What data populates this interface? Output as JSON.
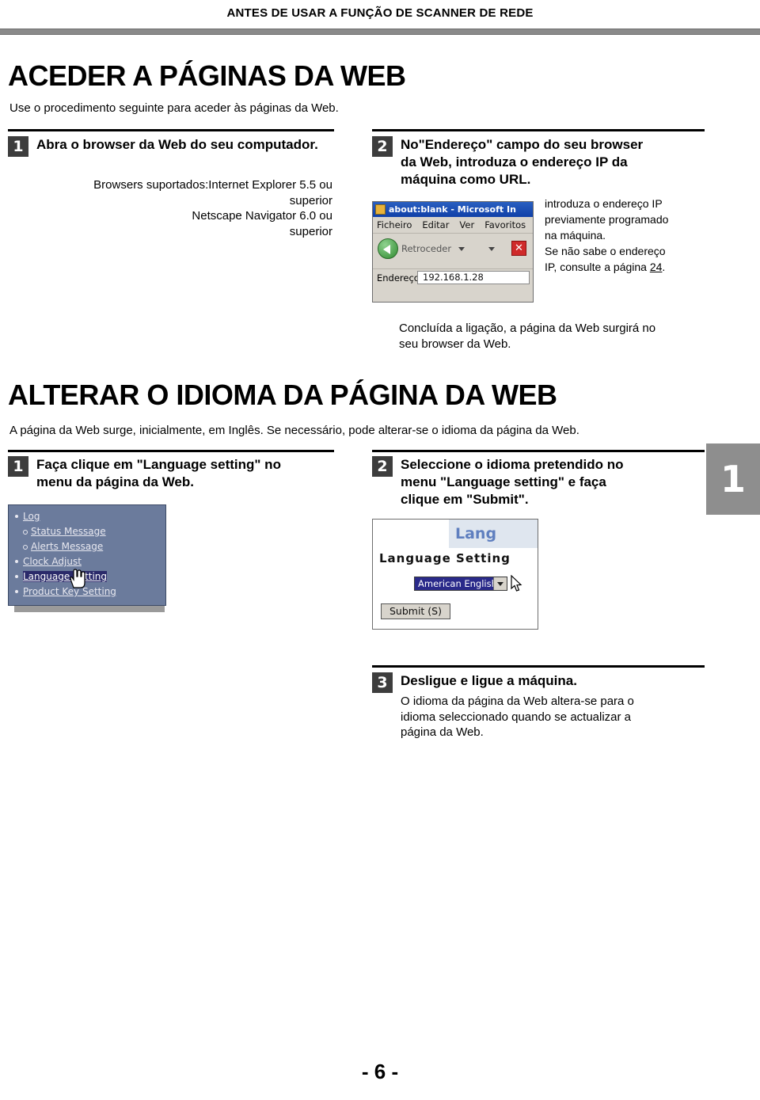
{
  "header": {
    "title": "ANTES DE USAR A FUNÇÃO DE SCANNER DE REDE"
  },
  "section1": {
    "title": "ACEDER A PÁGINAS DA WEB",
    "intro": "Use o procedimento seguinte para aceder às páginas da Web.",
    "steps": [
      {
        "num": "1",
        "head": "Abra o browser da Web do seu computador.",
        "body_line1": "Browsers suportados:Internet Explorer 5.5 ou",
        "body_line2": "superior",
        "body_line3": "Netscape Navigator 6.0 ou",
        "body_line4": "superior"
      },
      {
        "num": "2",
        "head_line1": "No\"Endereço\" campo do seu browser",
        "head_line2": "da Web, introduza o endereço IP da",
        "head_line3": "máquina como URL.",
        "body_line1": "introduza o endereço IP",
        "body_line2": "previamente programado",
        "body_line3": "na máquina.",
        "body_line4": "Se não sabe o endereço",
        "body_line5": "IP, consulte a página ",
        "body_page_ref": "24",
        "body_line5_end": "."
      }
    ],
    "note_line1": "Concluída a ligação, a página da Web surgirá no",
    "note_line2": "seu browser da Web."
  },
  "browser_shot": {
    "window_title": "about:blank - Microsoft In",
    "menu": [
      "Ficheiro",
      "Editar",
      "Ver",
      "Favoritos"
    ],
    "back_label": "Retroceder",
    "stop_label": "✕",
    "address_label": "Endereço",
    "address_value": "192.168.1.28"
  },
  "section2": {
    "title": "ALTERAR O IDIOMA DA PÁGINA DA WEB",
    "intro": "A página da Web surge, inicialmente, em Inglês. Se necessário, pode alterar-se o idioma da página da Web.",
    "steps": [
      {
        "num": "1",
        "head_line1": "Faça clique em \"Language setting\" no",
        "head_line2": "menu da página da Web."
      },
      {
        "num": "2",
        "head_line1": "Seleccione o idioma pretendido no",
        "head_line2": "menu \"Language setting\" e faça",
        "head_line3": "clique em \"Submit\"."
      },
      {
        "num": "3",
        "head": "Desligue e ligue a máquina.",
        "body_line1": "O idioma da página da Web altera-se para o",
        "body_line2": "idioma seleccionado quando se actualizar a",
        "body_line3": "página da Web."
      }
    ]
  },
  "menu_shot": {
    "items": [
      {
        "label": "Log",
        "sub": false,
        "selected": false
      },
      {
        "label": "Status Message",
        "sub": true,
        "selected": false
      },
      {
        "label": "Alerts Message",
        "sub": true,
        "selected": false
      },
      {
        "label": "Clock Adjust",
        "sub": false,
        "selected": false
      },
      {
        "label": "Language Setting",
        "sub": false,
        "selected": true
      },
      {
        "label": "Product Key Setting",
        "sub": false,
        "selected": false
      }
    ]
  },
  "lang_shot": {
    "banner": "Lang",
    "title": "Language Setting",
    "selected_option": "American English",
    "submit_label": "Submit (S)"
  },
  "page_tab": "1",
  "footer": "- 6 -"
}
